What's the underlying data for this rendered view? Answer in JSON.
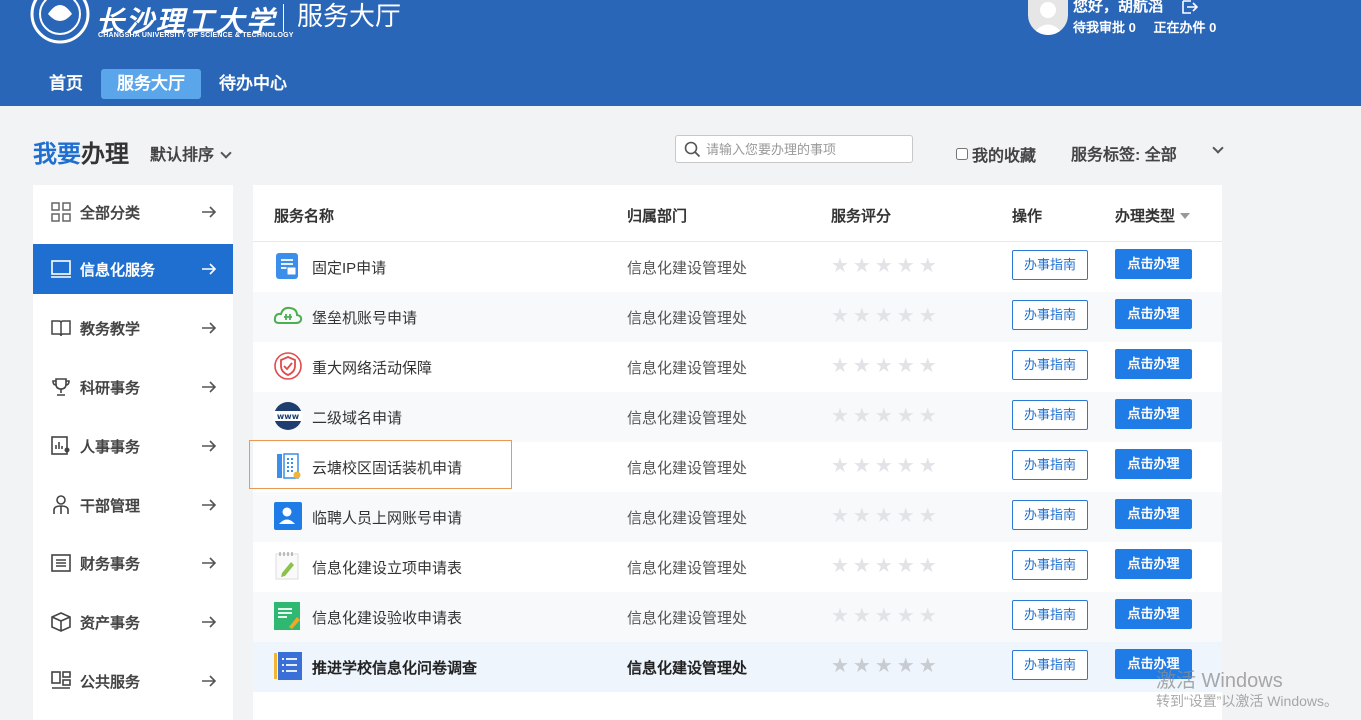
{
  "header": {
    "logo_text": "长沙理工大学",
    "logo_subtitle": "CHANGSHA UNIVERSITY OF SCIENCE & TECHNOLOGY",
    "site_title": "服务大厅",
    "greeting": "您好，胡航滔",
    "pending_approval": "待我审批 0",
    "in_progress": "正在办件 0",
    "nav": [
      {
        "label": "首页"
      },
      {
        "label": "服务大厅",
        "active": true
      },
      {
        "label": "待办中心"
      }
    ],
    "colors": {
      "bar": "#2a66b8",
      "active_nav": "#5ba6ea"
    }
  },
  "toolbar": {
    "heading_blue": "我要",
    "heading_dark": "办理",
    "sort_label": "默认排序",
    "search_placeholder": "请输入您要办理的事项",
    "favorites_label": "我的收藏",
    "tag_label": "服务标签:  全部"
  },
  "sidebar": {
    "items": [
      {
        "label": "全部分类",
        "icon": "grid-icon"
      },
      {
        "label": "信息化服务",
        "icon": "monitor-icon",
        "active": true
      },
      {
        "label": "教务教学",
        "icon": "book-icon"
      },
      {
        "label": "科研事务",
        "icon": "trophy-icon"
      },
      {
        "label": "人事事务",
        "icon": "chart-person-icon"
      },
      {
        "label": "干部管理",
        "icon": "person-icon"
      },
      {
        "label": "财务事务",
        "icon": "list-icon"
      },
      {
        "label": "资产事务",
        "icon": "box-icon"
      },
      {
        "label": "公共服务",
        "icon": "apps-icon"
      }
    ]
  },
  "table": {
    "headers": {
      "name": "服务名称",
      "dept": "归属部门",
      "rating": "服务评分",
      "ops": "操作",
      "type": "办理类型"
    },
    "guide_label": "办事指南",
    "do_label": "点击办理",
    "stars_text": "★★★★★",
    "rows": [
      {
        "name": "固定IP申请",
        "dept": "信息化建设管理处",
        "icon": "document-icon",
        "rating": 0
      },
      {
        "name": "堡垒机账号申请",
        "dept": "信息化建设管理处",
        "icon": "cloud-icon",
        "rating": 0
      },
      {
        "name": "重大网络活动保障",
        "dept": "信息化建设管理处",
        "icon": "shield-icon",
        "rating": 0
      },
      {
        "name": "二级域名申请",
        "dept": "信息化建设管理处",
        "icon": "www-icon",
        "rating": 0
      },
      {
        "name": "云塘校区固话装机申请",
        "dept": "信息化建设管理处",
        "icon": "phone-icon",
        "rating": 0
      },
      {
        "name": "临聘人员上网账号申请",
        "dept": "信息化建设管理处",
        "icon": "user-card-icon",
        "rating": 0
      },
      {
        "name": "信息化建设立项申请表",
        "dept": "信息化建设管理处",
        "icon": "notepad-icon",
        "rating": 0
      },
      {
        "name": "信息化建设验收申请表",
        "dept": "信息化建设管理处",
        "icon": "form-edit-icon",
        "rating": 0
      },
      {
        "name": "推进学校信息化问卷调查",
        "dept": "信息化建设管理处",
        "icon": "questionnaire-icon",
        "rating": 0
      }
    ]
  },
  "watermark": {
    "line1": "激活 Windows",
    "line2": "转到“设置”以激活 Windows。"
  }
}
